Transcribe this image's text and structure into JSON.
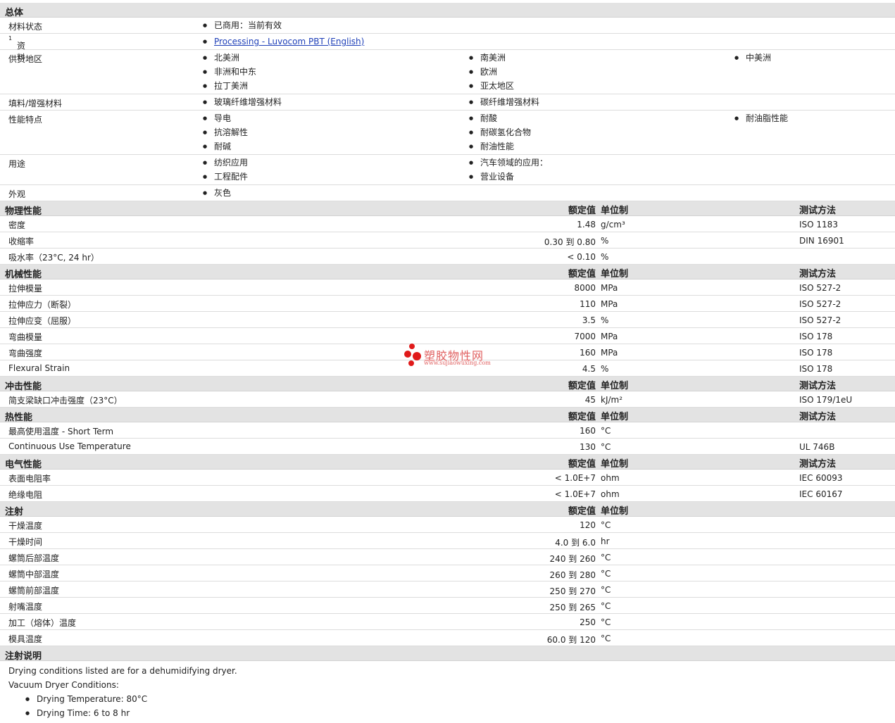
{
  "general": {
    "title": "总体",
    "rows": [
      {
        "label": "材料状态",
        "sup": "",
        "cols": [
          [
            "已商用：当前有效"
          ],
          [],
          []
        ],
        "link": false
      },
      {
        "label": "资料",
        "sup": "1",
        "cols": [
          [
            "Processing - Luvocom PBT (English)"
          ],
          [],
          []
        ],
        "link": true
      },
      {
        "label": "供货地区",
        "sup": "",
        "cols": [
          [
            "北美洲",
            "非洲和中东",
            "拉丁美洲"
          ],
          [
            "南美洲",
            "欧洲",
            "亚太地区"
          ],
          [
            "中美洲"
          ]
        ],
        "link": false
      },
      {
        "label": "填料/增强材料",
        "sup": "",
        "cols": [
          [
            "玻璃纤维增强材料"
          ],
          [
            "碳纤维增强材料"
          ],
          []
        ],
        "link": false
      },
      {
        "label": "性能特点",
        "sup": "",
        "cols": [
          [
            "导电",
            "抗溶解性",
            "耐碱"
          ],
          [
            "耐酸",
            "耐碳氢化合物",
            "耐油性能"
          ],
          [
            "耐油脂性能"
          ]
        ],
        "link": false
      },
      {
        "label": "用途",
        "sup": "",
        "cols": [
          [
            "纺织应用",
            "工程配件"
          ],
          [
            "汽车领域的应用：",
            "营业设备"
          ],
          []
        ],
        "link": false
      },
      {
        "label": "外观",
        "sup": "",
        "cols": [
          [
            "灰色"
          ],
          [],
          []
        ],
        "link": false
      }
    ]
  },
  "headers": {
    "value": "额定值",
    "unit": "单位制",
    "test": "测试方法"
  },
  "sections": [
    {
      "title": "物理性能",
      "show_test": true,
      "rows": [
        {
          "label": "密度",
          "value": "1.48",
          "unit": "g/cm³",
          "test": "ISO 1183"
        },
        {
          "label": "收缩率",
          "value": "0.30 到  0.80",
          "unit": "%",
          "test": "DIN 16901"
        },
        {
          "label": "吸水率（23°C, 24 hr）",
          "value": "< 0.10",
          "unit": "%",
          "test": ""
        }
      ]
    },
    {
      "title": "机械性能",
      "show_test": true,
      "rows": [
        {
          "label": "拉伸模量",
          "value": "8000",
          "unit": "MPa",
          "test": "ISO 527-2"
        },
        {
          "label": "拉伸应力（断裂）",
          "value": "110",
          "unit": "MPa",
          "test": "ISO 527-2"
        },
        {
          "label": "拉伸应变（屈服）",
          "value": "3.5",
          "unit": "%",
          "test": "ISO 527-2"
        },
        {
          "label": "弯曲模量",
          "value": "7000",
          "unit": "MPa",
          "test": "ISO 178"
        },
        {
          "label": "弯曲强度",
          "value": "160",
          "unit": "MPa",
          "test": "ISO 178"
        },
        {
          "label": "Flexural Strain",
          "value": "4.5",
          "unit": "%",
          "test": "ISO 178"
        }
      ]
    },
    {
      "title": "冲击性能",
      "show_test": true,
      "rows": [
        {
          "label": "简支梁缺口冲击强度（23°C）",
          "value": "45",
          "unit": "kJ/m²",
          "test": "ISO 179/1eU"
        }
      ]
    },
    {
      "title": "热性能",
      "show_test": true,
      "rows": [
        {
          "label": "最高使用温度  - Short Term",
          "value": "160",
          "unit": "°C",
          "test": ""
        },
        {
          "label": "Continuous Use Temperature",
          "value": "130",
          "unit": "°C",
          "test": "UL 746B"
        }
      ]
    },
    {
      "title": "电气性能",
      "show_test": true,
      "rows": [
        {
          "label": "表面电阻率",
          "value": "< 1.0E+7",
          "unit": "ohm",
          "test": "IEC 60093"
        },
        {
          "label": "绝缘电阻",
          "value": "< 1.0E+7",
          "unit": "ohm",
          "test": "IEC 60167"
        }
      ]
    },
    {
      "title": "注射",
      "show_test": false,
      "rows": [
        {
          "label": "干燥温度",
          "value": "120",
          "unit": "°C",
          "test": ""
        },
        {
          "label": "干燥时间",
          "value": "4.0 到  6.0",
          "unit": "hr",
          "test": ""
        },
        {
          "label": "螺筒后部温度",
          "value": "240 到  260",
          "unit": "°C",
          "test": ""
        },
        {
          "label": "螺筒中部温度",
          "value": "260 到  280",
          "unit": "°C",
          "test": ""
        },
        {
          "label": "螺筒前部温度",
          "value": "250 到  270",
          "unit": "°C",
          "test": ""
        },
        {
          "label": "射嘴温度",
          "value": "250 到  265",
          "unit": "°C",
          "test": ""
        },
        {
          "label": "加工（熔体）温度",
          "value": "250",
          "unit": "°C",
          "test": ""
        },
        {
          "label": "模具温度",
          "value": "60.0 到  120",
          "unit": "°C",
          "test": ""
        }
      ]
    }
  ],
  "notes": {
    "title": "注射说明",
    "lines": [
      "Drying conditions listed are for a dehumidifying dryer.",
      "Vacuum Dryer Conditions:"
    ],
    "bullets": [
      "Drying Temperature: 80°C",
      "Drying Time: 6 to 8 hr"
    ]
  },
  "watermark": {
    "cn": "塑胶物性网",
    "en": "www.sujiaowuxing.com",
    "color": "#e01a1a"
  }
}
